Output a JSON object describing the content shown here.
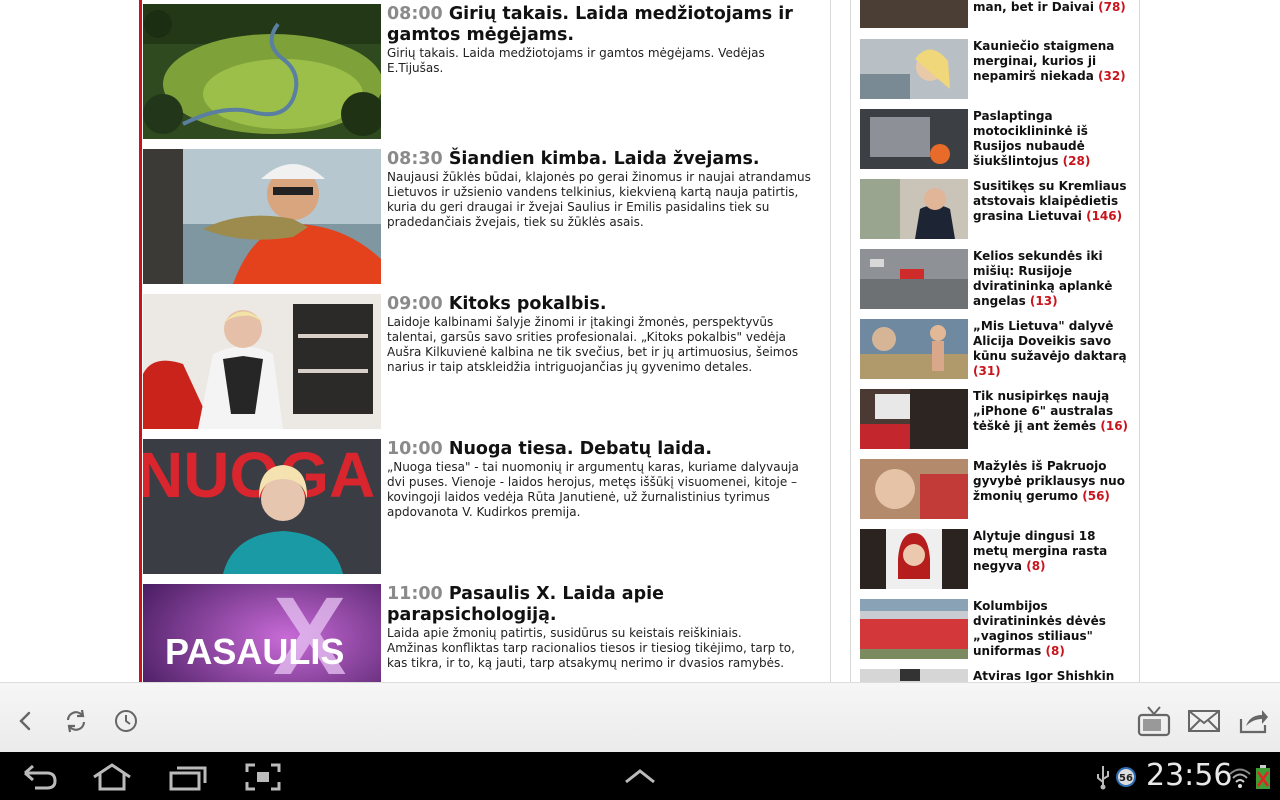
{
  "programs": [
    {
      "time": "08:00",
      "title": "Girių takais. Laida medžiotojams ir gamtos mėgėjams.",
      "desc": "Girių takais. Laida medžiotojams ir gamtos mėgėjams. Vedėjas E.Tijušas."
    },
    {
      "time": "08:30",
      "title": "Šiandien kimba. Laida žvejams.",
      "desc": "Naujausi žūklės būdai, klajonės po gerai žinomus ir naujai atrandamus Lietuvos ir užsienio vandens telkinius, kiekvieną kartą nauja patirtis, kuria du geri draugai ir žvejai Saulius ir Emilis pasidalins tiek su pradedančiais žvejais, tiek su žūklės asais."
    },
    {
      "time": "09:00",
      "title": "Kitoks pokalbis.",
      "desc": "Laidoje kalbinami šalyje žinomi ir įtakingi žmonės, perspektyvūs talentai, garsūs savo srities profesionalai. „Kitoks pokalbis\" vedėja Aušra Kilkuvienė kalbina ne tik svečius, bet ir jų artimuosius, šeimos narius ir taip atskleidžia intriguojančias jų gyvenimo detales."
    },
    {
      "time": "10:00",
      "title": "Nuoga tiesa. Debatų laida.",
      "desc": "„Nuoga tiesa\" - tai nuomonių ir argumentų karas, kuriame dalyvauja dvi puses. Vienoje - laidos herojus, metęs iššūkį visuomenei, kitoje – kovingoji laidos vedėja Rūta Janutienė, už žurnalistinius tyrimus apdovanota V. Kudirkos premija.",
      "thumb_text": "NUOGA"
    },
    {
      "time": "11:00",
      "title": "Pasaulis X. Laida apie parapsichologiją.",
      "desc": "Laida apie žmonių patirtis, susidūrus su keistais reiškiniais.\nAmžinas konfliktas tarp racionalios tiesos ir tiesiog tikėjimo, tarp to,\nkas tikra, ir to, ką jauti, tarp atsakymų nerimo ir dvasios ramybės.",
      "thumb_text_1": "PASAULIS",
      "thumb_text_2": "X"
    }
  ],
  "news": [
    {
      "title": "man, bet ir Daivai",
      "count": "(78)"
    },
    {
      "title": "Kauniečio staigmena merginai, kurios ji nepamirš niekada",
      "count": "(32)"
    },
    {
      "title": "Paslaptinga motociklininkė iš Rusijos nubaudė šiukšlintojus",
      "count": "(28)"
    },
    {
      "title": "Susitikęs su Kremliaus atstovais klaipėdietis grasina Lietuvai",
      "count": "(146)"
    },
    {
      "title": "Kelios sekundės iki mišių: Rusijoje dviratininką aplankė angelas",
      "count": "(13)"
    },
    {
      "title": "„Mis Lietuva\" dalyvė Alicija Doveikis savo kūnu sužavėjo daktarą",
      "count": "(31)"
    },
    {
      "title": "Tik nusipirkęs naują „iPhone 6\" australas tėškė jį ant žemės",
      "count": "(16)"
    },
    {
      "title": "Mažylės iš Pakruojo gyvybė priklausys nuo žmonių gerumo",
      "count": "(56)"
    },
    {
      "title": "Alytuje dingusi 18 metų mergina rasta negyva",
      "count": "(8)"
    },
    {
      "title": "Kolumbijos dviratininkės dėvės „vaginos stiliaus\" uniformas",
      "count": "(8)"
    },
    {
      "title": "Atviras Igor Shishkin",
      "count": ""
    }
  ],
  "statusbar": {
    "time": "23:56",
    "badge": "56"
  }
}
